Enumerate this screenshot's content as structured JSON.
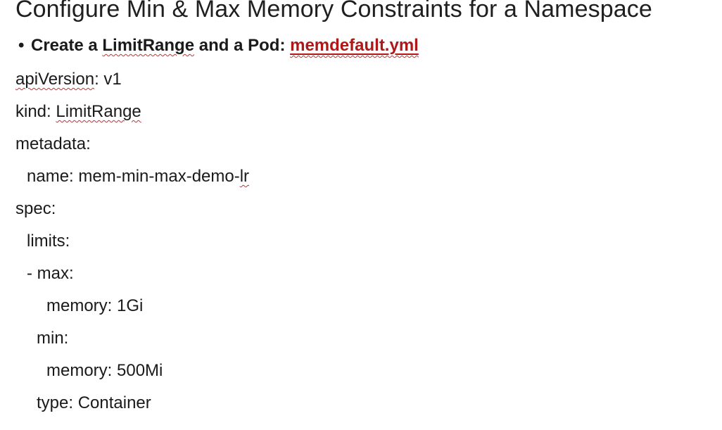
{
  "slide": {
    "title": "Configure Min & Max Memory Constraints for a Namespace",
    "bullet": {
      "prefix": "Create a ",
      "limitrange_word": "LimitRange",
      "middle": " and a Pod",
      "separator": ": ",
      "filename": "memdefault.yml"
    },
    "code": {
      "line1_key": "apiVersion",
      "line1_rest": ": v1",
      "line2_key": "kind: ",
      "line2_value": "LimitRange",
      "line3": "metadata:",
      "line4_text": "name: mem-min-max-demo-",
      "line4_tail": "lr",
      "line5": "spec:",
      "line6": "limits:",
      "line7": "- max:",
      "line8": "memory: 1Gi",
      "line9": "min:",
      "line10": "memory: 500Mi",
      "line11": "type: Container"
    }
  }
}
